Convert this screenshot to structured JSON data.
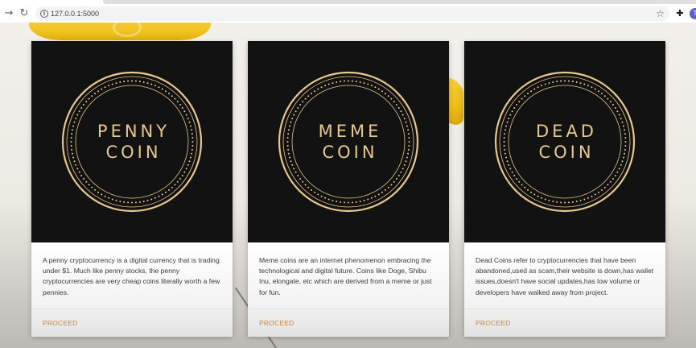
{
  "browser": {
    "url": "127.0.0.1:5000",
    "back_icon": "arrow-right-icon",
    "reload_icon": "reload-icon",
    "info_icon": "info-icon",
    "bookmark_icon": "star-icon",
    "extensions_icon": "puzzle-icon",
    "profile_initial": "T"
  },
  "theme": {
    "card_media_bg": "#121212",
    "coin_gold": "#e8c78d",
    "proceed_color": "#c8873a"
  },
  "cards": [
    {
      "coin_lines": [
        "PENNY",
        "COIN"
      ],
      "description": "A penny cryptocurrency is a digital currency that is trading under $1. Much like penny stocks, the penny cryptocurrencies are very cheap coins literally worth a few pennies.",
      "action_label": "PROCEED"
    },
    {
      "coin_lines": [
        "MEME",
        "COIN"
      ],
      "description": "Meme coins are an internet phenomenon embracing the technological and digital future. Coins like Doge, Shibu Inu, elongate, etc which are derived from a meme or just for fun.",
      "action_label": "PROCEED"
    },
    {
      "coin_lines": [
        "DEAD",
        "COIN"
      ],
      "description": "Dead Coins refer to cryptocurrencies that have been abandoned,used as scam,their website is down,has wallet issues,doesn't have social updates,has low volume or developers have walked away from project.",
      "action_label": "PROCEED"
    }
  ]
}
